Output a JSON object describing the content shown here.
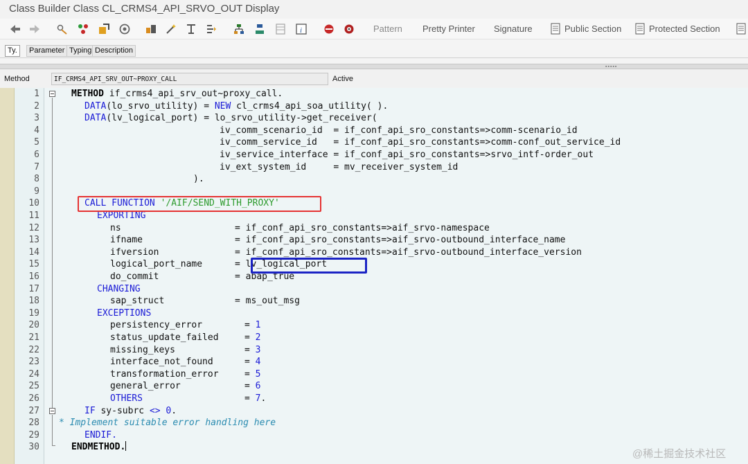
{
  "window": {
    "title": "Class Builder Class CL_CRMS4_API_SRVO_OUT Display"
  },
  "toolbar": {
    "pattern": "Pattern",
    "pretty_printer": "Pretty Printer",
    "signature": "Signature",
    "public_section": "Public Section",
    "protected_section": "Protected Section"
  },
  "tabs": {
    "ty": "Ty.",
    "parameter": "Parameter",
    "typing": "Typing",
    "description": "Description"
  },
  "method_bar": {
    "label": "Method",
    "value": "IF_CRMS4_API_SRV_OUT~PROXY_CALL",
    "status": "Active"
  },
  "line_numbers": [
    "1",
    "2",
    "3",
    "4",
    "5",
    "6",
    "7",
    "8",
    "9",
    "10",
    "11",
    "12",
    "13",
    "14",
    "15",
    "16",
    "17",
    "18",
    "19",
    "20",
    "21",
    "22",
    "23",
    "24",
    "25",
    "26",
    "27",
    "28",
    "29",
    "30"
  ],
  "code": {
    "l1a": "METHOD",
    "l1b": " if_crms4_api_srv_out~proxy_call.",
    "l2a": "DATA",
    "l2b": "(lo_srvo_utility) = ",
    "l2c": "NEW",
    "l2d": " cl_crms4_api_soa_utility( ).",
    "l3a": "DATA",
    "l3b": "(lv_logical_port) = lo_srvo_utility->get_receiver(",
    "l4": "iv_comm_scenario_id  = if_conf_api_sro_constants=>comm-scenario_id",
    "l5": "iv_comm_service_id   = if_conf_api_sro_constants=>comm-conf_out_service_id",
    "l6": "iv_service_interface = if_conf_api_sro_constants=>srvo_intf-order_out",
    "l7": "iv_ext_system_id     = mv_receiver_system_id",
    "l8": ").",
    "l10a": "CALL FUNCTION",
    "l10b": "'/AIF/SEND_WITH_PROXY'",
    "l11": "EXPORTING",
    "l12": "ns                     = if_conf_api_sro_constants=>aif_srvo-namespace",
    "l13": "ifname                 = if_conf_api_sro_constants=>aif_srvo-outbound_interface_name",
    "l14": "ifversion              = if_conf_api_sro_constants=>aif_srvo-outbound_interface_version",
    "l15": "logical_port_name      = lv_logical_port",
    "l16": "do_commit              = abap_true",
    "l17": "CHANGING",
    "l18": "sap_struct             = ms_out_msg",
    "l19": "EXCEPTIONS",
    "l20a": "persistency_error",
    "l20b": "1",
    "l21a": "status_update_failed",
    "l21b": "2",
    "l22a": "missing_keys",
    "l22b": "3",
    "l23a": "interface_not_found",
    "l23b": "4",
    "l24a": "transformation_error",
    "l24b": "5",
    "l25a": "general_error",
    "l25b": "6",
    "l26a": "OTHERS",
    "l26b": "7",
    "l27a": "IF",
    "l27b": " sy-subrc ",
    "l27c": "<>",
    "l27d": " 0",
    "l28": "* Implement suitable error handling here",
    "l29": "ENDIF.",
    "l30": "ENDMETHOD."
  },
  "watermark": "@稀土掘金技术社区"
}
